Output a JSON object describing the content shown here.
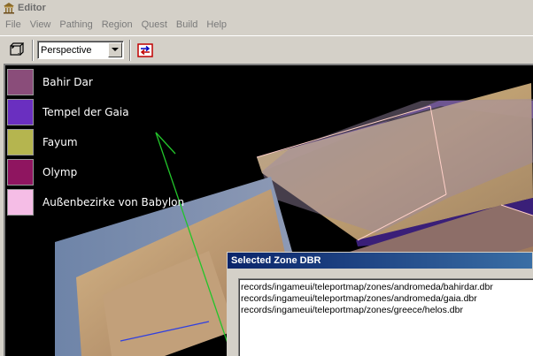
{
  "window": {
    "title": "Editor"
  },
  "menu": [
    "File",
    "View",
    "Pathing",
    "Region",
    "Quest",
    "Build",
    "Help"
  ],
  "toolbar": {
    "view_mode": "Perspective"
  },
  "legend": [
    {
      "label": "Bahir Dar",
      "color": "#8a4d7a"
    },
    {
      "label": "Tempel der Gaia",
      "color": "#6a2fc0"
    },
    {
      "label": "Fayum",
      "color": "#b5b54f"
    },
    {
      "label": "Olymp",
      "color": "#8f1560"
    },
    {
      "label": "Außenbezirke von Babylon",
      "color": "#f5bde6"
    }
  ],
  "zone_dbr": {
    "title": "Selected Zone DBR",
    "entries": [
      "records/ingameui/teleportmap/zones/andromeda/bahirdar.dbr",
      "records/ingameui/teleportmap/zones/andromeda/gaia.dbr",
      "records/ingameui/teleportmap/zones/greece/helos.dbr"
    ]
  }
}
